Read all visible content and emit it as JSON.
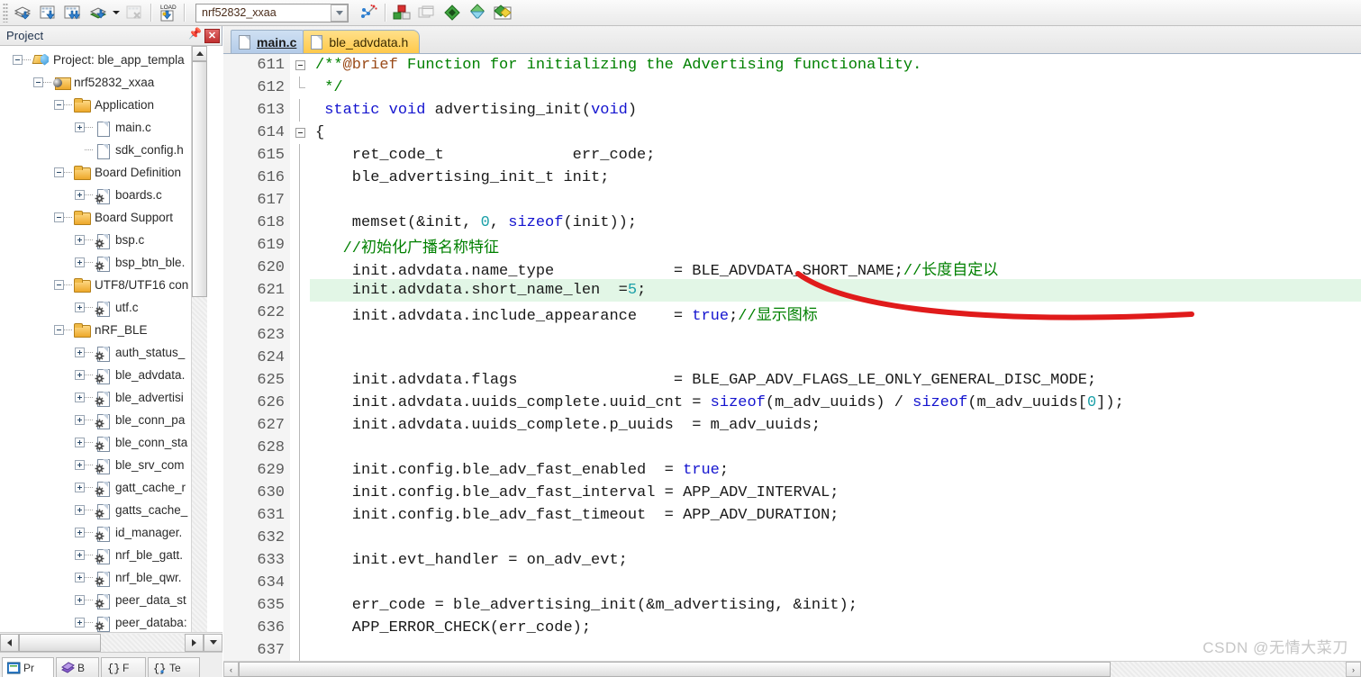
{
  "toolbar": {
    "icons": [
      {
        "name": "translate-icon",
        "glyph": "translate"
      },
      {
        "name": "build-icon",
        "glyph": "build"
      },
      {
        "name": "rebuild-icon",
        "glyph": "rebuild"
      },
      {
        "name": "batch-build-icon",
        "glyph": "batch-build"
      },
      {
        "name": "batch-build-dropdown-icon",
        "glyph": "caret"
      },
      {
        "name": "stop-build-icon",
        "glyph": "stop-build"
      },
      {
        "name": "download-icon",
        "glyph": "load"
      }
    ],
    "target_combo": {
      "value": "nrf52832_xxaa",
      "dropdown_icon": "chevron-down-icon"
    },
    "right_icons": [
      {
        "name": "configure-target-icon",
        "glyph": "wizard"
      },
      {
        "name": "manage-components-icon",
        "glyph": "components"
      },
      {
        "name": "windows-icon",
        "glyph": "windows"
      },
      {
        "name": "green-diamond-icon",
        "glyph": "diamond"
      },
      {
        "name": "filter-icon",
        "glyph": "funnel"
      },
      {
        "name": "pack-installer-icon",
        "glyph": "pack"
      }
    ]
  },
  "project_pane": {
    "title": "Project",
    "pin_icon": "pin-icon",
    "close_icon": "close-icon",
    "tree": [
      {
        "label": "Project: ble_app_templa",
        "depth": 0,
        "expander": "minus",
        "icon": "project-icon"
      },
      {
        "label": "nrf52832_xxaa",
        "depth": 1,
        "expander": "minus",
        "icon": "target-icon"
      },
      {
        "label": "Application",
        "depth": 2,
        "expander": "minus",
        "icon": "folder-icon"
      },
      {
        "label": "main.c",
        "depth": 3,
        "expander": "plus",
        "icon": "doc-icon"
      },
      {
        "label": "sdk_config.h",
        "depth": 3,
        "expander": "none",
        "icon": "doc-icon"
      },
      {
        "label": "Board Definition",
        "depth": 2,
        "expander": "minus",
        "icon": "folder-icon"
      },
      {
        "label": "boards.c",
        "depth": 3,
        "expander": "plus",
        "icon": "doc-gear-icon"
      },
      {
        "label": "Board Support",
        "depth": 2,
        "expander": "minus",
        "icon": "folder-icon"
      },
      {
        "label": "bsp.c",
        "depth": 3,
        "expander": "plus",
        "icon": "doc-gear-icon"
      },
      {
        "label": "bsp_btn_ble.",
        "depth": 3,
        "expander": "plus",
        "icon": "doc-gear-icon"
      },
      {
        "label": "UTF8/UTF16 con",
        "depth": 2,
        "expander": "minus",
        "icon": "folder-icon"
      },
      {
        "label": "utf.c",
        "depth": 3,
        "expander": "plus",
        "icon": "doc-gear-icon"
      },
      {
        "label": "nRF_BLE",
        "depth": 2,
        "expander": "minus",
        "icon": "folder-icon"
      },
      {
        "label": "auth_status_",
        "depth": 3,
        "expander": "plus",
        "icon": "doc-gear-icon"
      },
      {
        "label": "ble_advdata.",
        "depth": 3,
        "expander": "plus",
        "icon": "doc-gear-icon"
      },
      {
        "label": "ble_advertisi",
        "depth": 3,
        "expander": "plus",
        "icon": "doc-gear-icon"
      },
      {
        "label": "ble_conn_pa",
        "depth": 3,
        "expander": "plus",
        "icon": "doc-gear-icon"
      },
      {
        "label": "ble_conn_sta",
        "depth": 3,
        "expander": "plus",
        "icon": "doc-gear-icon"
      },
      {
        "label": "ble_srv_com",
        "depth": 3,
        "expander": "plus",
        "icon": "doc-gear-icon"
      },
      {
        "label": "gatt_cache_r",
        "depth": 3,
        "expander": "plus",
        "icon": "doc-gear-icon"
      },
      {
        "label": "gatts_cache_",
        "depth": 3,
        "expander": "plus",
        "icon": "doc-gear-icon"
      },
      {
        "label": "id_manager.",
        "depth": 3,
        "expander": "plus",
        "icon": "doc-gear-icon"
      },
      {
        "label": "nrf_ble_gatt.",
        "depth": 3,
        "expander": "plus",
        "icon": "doc-gear-icon"
      },
      {
        "label": "nrf_ble_qwr.",
        "depth": 3,
        "expander": "plus",
        "icon": "doc-gear-icon"
      },
      {
        "label": "peer_data_st",
        "depth": 3,
        "expander": "plus",
        "icon": "doc-gear-icon"
      },
      {
        "label": "peer_databa:",
        "depth": 3,
        "expander": "plus",
        "icon": "doc-gear-icon"
      }
    ],
    "bottom_tabs": [
      {
        "label": "Pr",
        "icon": "project-tab-icon",
        "active": true
      },
      {
        "label": "B",
        "icon": "books-tab-icon",
        "active": false
      },
      {
        "label": "F",
        "icon": "functions-tab-icon",
        "active": false
      },
      {
        "label": "Te",
        "icon": "templates-tab-icon",
        "active": false
      }
    ]
  },
  "editor": {
    "tabs": [
      {
        "label": "main.c",
        "active": true,
        "style": "blue"
      },
      {
        "label": "ble_advdata.h",
        "active": false,
        "style": "yellow"
      }
    ],
    "first_line_number": 611,
    "lines": [
      {
        "num": "611",
        "fold": "start",
        "hl": false,
        "spans": [
          {
            "t": "/**",
            "c": "c-comment"
          },
          {
            "t": "@brief",
            "c": "c-brief"
          },
          {
            "t": " Function for initializing the Advertising functionality.",
            "c": "c-comment"
          }
        ]
      },
      {
        "num": "612",
        "fold": "end",
        "hl": false,
        "spans": [
          {
            "t": " */",
            "c": "c-comment"
          }
        ]
      },
      {
        "num": "613",
        "fold": "bar",
        "hl": false,
        "spans": [
          {
            "t": " ",
            "c": "c-plain"
          },
          {
            "t": "static void",
            "c": "c-kw"
          },
          {
            "t": " advertising_init(",
            "c": "c-plain"
          },
          {
            "t": "void",
            "c": "c-kw"
          },
          {
            "t": ")",
            "c": "c-plain"
          }
        ]
      },
      {
        "num": "614",
        "fold": "start",
        "hl": false,
        "spans": [
          {
            "t": "{",
            "c": "c-plain"
          }
        ]
      },
      {
        "num": "615",
        "fold": "bar",
        "hl": false,
        "spans": [
          {
            "t": "    ret_code_t              err_code;",
            "c": "c-plain"
          }
        ]
      },
      {
        "num": "616",
        "fold": "bar",
        "hl": false,
        "spans": [
          {
            "t": "    ble_advertising_init_t init;",
            "c": "c-plain"
          }
        ]
      },
      {
        "num": "617",
        "fold": "bar",
        "hl": false,
        "spans": [
          {
            "t": "",
            "c": "c-plain"
          }
        ]
      },
      {
        "num": "618",
        "fold": "bar",
        "hl": false,
        "spans": [
          {
            "t": "    memset(&init, ",
            "c": "c-plain"
          },
          {
            "t": "0",
            "c": "c-num"
          },
          {
            "t": ", ",
            "c": "c-plain"
          },
          {
            "t": "sizeof",
            "c": "c-kw"
          },
          {
            "t": "(init));",
            "c": "c-plain"
          }
        ]
      },
      {
        "num": "619",
        "fold": "bar",
        "hl": false,
        "spans": [
          {
            "t": "   //初始化广播名称特征",
            "c": "c-comment"
          }
        ]
      },
      {
        "num": "620",
        "fold": "bar",
        "hl": false,
        "spans": [
          {
            "t": "    init.advdata.name_type             = BLE_ADVDATA_SHORT_NAME;",
            "c": "c-plain"
          },
          {
            "t": "//长度自定以",
            "c": "c-comment"
          }
        ]
      },
      {
        "num": "621",
        "fold": "bar",
        "hl": true,
        "spans": [
          {
            "t": "    init.advdata.short_name_len  =",
            "c": "c-plain"
          },
          {
            "t": "5",
            "c": "c-num"
          },
          {
            "t": ";",
            "c": "c-plain"
          }
        ]
      },
      {
        "num": "622",
        "fold": "bar",
        "hl": false,
        "spans": [
          {
            "t": "    init.advdata.include_appearance    = ",
            "c": "c-plain"
          },
          {
            "t": "true",
            "c": "c-kw"
          },
          {
            "t": ";",
            "c": "c-plain"
          },
          {
            "t": "//显示图标",
            "c": "c-comment"
          }
        ]
      },
      {
        "num": "623",
        "fold": "bar",
        "hl": false,
        "spans": [
          {
            "t": "",
            "c": "c-plain"
          }
        ]
      },
      {
        "num": "624",
        "fold": "bar",
        "hl": false,
        "spans": [
          {
            "t": "",
            "c": "c-plain"
          }
        ]
      },
      {
        "num": "625",
        "fold": "bar",
        "hl": false,
        "spans": [
          {
            "t": "    init.advdata.flags                 = BLE_GAP_ADV_FLAGS_LE_ONLY_GENERAL_DISC_MODE;",
            "c": "c-plain"
          }
        ]
      },
      {
        "num": "626",
        "fold": "bar",
        "hl": false,
        "spans": [
          {
            "t": "    init.advdata.uuids_complete.uuid_cnt = ",
            "c": "c-plain"
          },
          {
            "t": "sizeof",
            "c": "c-kw"
          },
          {
            "t": "(m_adv_uuids) / ",
            "c": "c-plain"
          },
          {
            "t": "sizeof",
            "c": "c-kw"
          },
          {
            "t": "(m_adv_uuids[",
            "c": "c-plain"
          },
          {
            "t": "0",
            "c": "c-num"
          },
          {
            "t": "]);",
            "c": "c-plain"
          }
        ]
      },
      {
        "num": "627",
        "fold": "bar",
        "hl": false,
        "spans": [
          {
            "t": "    init.advdata.uuids_complete.p_uuids  = m_adv_uuids;",
            "c": "c-plain"
          }
        ]
      },
      {
        "num": "628",
        "fold": "bar",
        "hl": false,
        "spans": [
          {
            "t": "",
            "c": "c-plain"
          }
        ]
      },
      {
        "num": "629",
        "fold": "bar",
        "hl": false,
        "spans": [
          {
            "t": "    init.config.ble_adv_fast_enabled  = ",
            "c": "c-plain"
          },
          {
            "t": "true",
            "c": "c-kw"
          },
          {
            "t": ";",
            "c": "c-plain"
          }
        ]
      },
      {
        "num": "630",
        "fold": "bar",
        "hl": false,
        "spans": [
          {
            "t": "    init.config.ble_adv_fast_interval = APP_ADV_INTERVAL;",
            "c": "c-plain"
          }
        ]
      },
      {
        "num": "631",
        "fold": "bar",
        "hl": false,
        "spans": [
          {
            "t": "    init.config.ble_adv_fast_timeout  = APP_ADV_DURATION;",
            "c": "c-plain"
          }
        ]
      },
      {
        "num": "632",
        "fold": "bar",
        "hl": false,
        "spans": [
          {
            "t": "",
            "c": "c-plain"
          }
        ]
      },
      {
        "num": "633",
        "fold": "bar",
        "hl": false,
        "spans": [
          {
            "t": "    init.evt_handler = on_adv_evt;",
            "c": "c-plain"
          }
        ]
      },
      {
        "num": "634",
        "fold": "bar",
        "hl": false,
        "spans": [
          {
            "t": "",
            "c": "c-plain"
          }
        ]
      },
      {
        "num": "635",
        "fold": "bar",
        "hl": false,
        "spans": [
          {
            "t": "    err_code = ble_advertising_init(&m_advertising, &init);",
            "c": "c-plain"
          }
        ]
      },
      {
        "num": "636",
        "fold": "bar",
        "hl": false,
        "spans": [
          {
            "t": "    APP_ERROR_CHECK(err_code);",
            "c": "c-plain"
          }
        ]
      },
      {
        "num": "637",
        "fold": "bar",
        "hl": false,
        "spans": [
          {
            "t": "",
            "c": "c-plain"
          }
        ]
      }
    ],
    "scroll_left_icon": "chevron-left-icon",
    "scroll_right_icon": "chevron-right-icon"
  },
  "annotation": {
    "name": "red-underline-stroke",
    "color": "#e01b1b"
  },
  "watermark": {
    "text": "CSDN @无情大菜刀"
  },
  "colors": {
    "comment": "#008000",
    "keyword": "#1414cf",
    "number": "#1ba0a8",
    "brief": "#9a4a18",
    "highlight_line": "#e2f6e6",
    "tab_active_yellow": "#ffc94b",
    "tab_blue": "#b3cbe8",
    "annotation_red": "#e01b1b"
  }
}
